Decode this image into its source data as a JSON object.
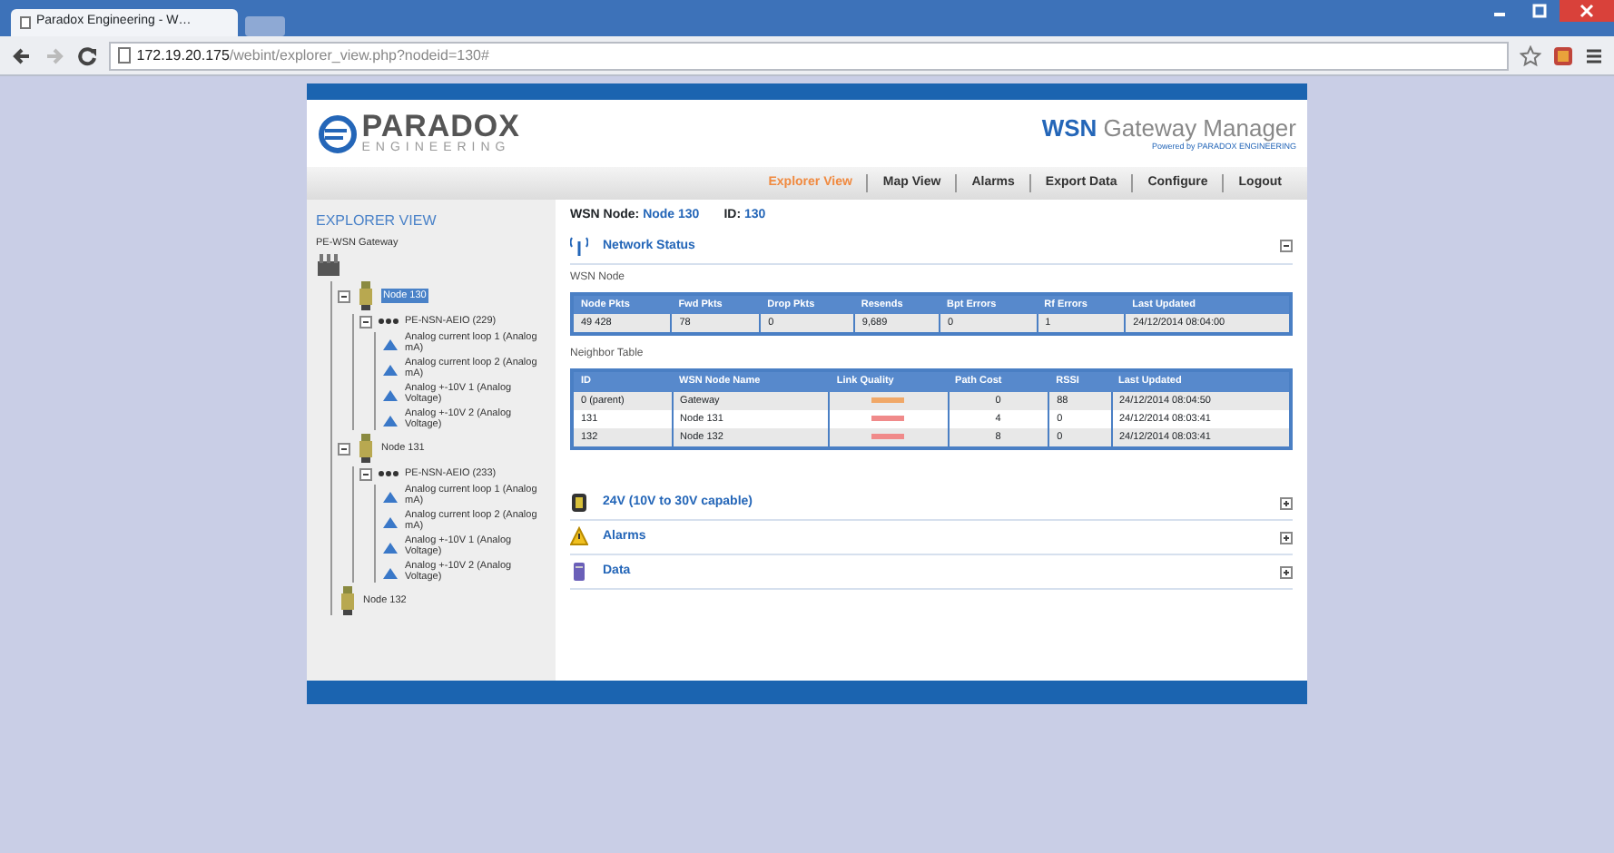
{
  "browser": {
    "tab_title": "Paradox Engineering - W…",
    "url_host": "172.19.20.175",
    "url_path": "/webint/explorer_view.php?nodeid=130#"
  },
  "header": {
    "logo_main": "PARADOX",
    "logo_sub": "ENGINEERING",
    "app_title_strong": "WSN",
    "app_title_rest": "Gateway Manager",
    "powered_by": "Powered by PARADOX ENGINEERING"
  },
  "nav": [
    {
      "label": "Explorer View",
      "selected": true
    },
    {
      "label": "Map View",
      "selected": false
    },
    {
      "label": "Alarms",
      "selected": false
    },
    {
      "label": "Export Data",
      "selected": false
    },
    {
      "label": "Configure",
      "selected": false
    },
    {
      "label": "Logout",
      "selected": false
    }
  ],
  "sidebar": {
    "title": "EXPLORER VIEW",
    "tree": [
      {
        "kind": "gateway",
        "label": "PE-WSN Gateway",
        "selected": false,
        "children": [
          {
            "kind": "node",
            "label": "Node 130",
            "selected": true,
            "expanded": true,
            "children": [
              {
                "kind": "device",
                "label": "PE-NSN-AEIO (229)",
                "selected": false,
                "expanded": true,
                "children": [
                  {
                    "kind": "sensor",
                    "label": "Analog current loop 1 (Analog mA)",
                    "selected": false
                  },
                  {
                    "kind": "sensor",
                    "label": "Analog current loop 2 (Analog mA)",
                    "selected": false
                  },
                  {
                    "kind": "sensor",
                    "label": "Analog +-10V 1 (Analog Voltage)",
                    "selected": false
                  },
                  {
                    "kind": "sensor",
                    "label": "Analog +-10V 2 (Analog Voltage)",
                    "selected": false
                  }
                ]
              }
            ]
          },
          {
            "kind": "node",
            "label": "Node 131",
            "selected": false,
            "expanded": true,
            "children": [
              {
                "kind": "device",
                "label": "PE-NSN-AEIO (233)",
                "selected": false,
                "expanded": true,
                "children": [
                  {
                    "kind": "sensor",
                    "label": "Analog current loop 1 (Analog mA)",
                    "selected": false
                  },
                  {
                    "kind": "sensor",
                    "label": "Analog current loop 2 (Analog mA)",
                    "selected": false
                  },
                  {
                    "kind": "sensor",
                    "label": "Analog +-10V 1 (Analog Voltage)",
                    "selected": false
                  },
                  {
                    "kind": "sensor",
                    "label": "Analog +-10V 2 (Analog Voltage)",
                    "selected": false
                  }
                ]
              }
            ]
          },
          {
            "kind": "node",
            "label": "Node 132",
            "selected": false
          }
        ]
      }
    ]
  },
  "main": {
    "node_label": "WSN Node:",
    "node_value": "Node 130",
    "id_label": "ID:",
    "id_value": "130",
    "sections": [
      {
        "kind": "network",
        "title": "Network Status",
        "expanded": true,
        "wsn_caption": "WSN Node",
        "wsn_table": {
          "columns": [
            "Node Pkts",
            "Fwd Pkts",
            "Drop Pkts",
            "Resends",
            "Bpt Errors",
            "Rf Errors",
            "Last Updated"
          ],
          "rows": [
            [
              "49 428",
              "78",
              "0",
              "9,689",
              "0",
              "1",
              "24/12/2014 08:04:00"
            ]
          ]
        },
        "neighbor_caption": "Neighbor Table",
        "neighbor_table": {
          "columns": [
            "ID",
            "WSN Node Name",
            "Link Quality",
            "Path Cost",
            "RSSI",
            "Last Updated"
          ],
          "rows": [
            {
              "id": "0 (parent)",
              "name": "Gateway",
              "quality": {
                "color": "#f0a868"
              },
              "cost": "0",
              "rssi": "88",
              "updated": "24/12/2014 08:04:50"
            },
            {
              "id": "131",
              "name": "Node 131",
              "quality": {
                "color": "#f08a8a"
              },
              "cost": "4",
              "rssi": "0",
              "updated": "24/12/2014 08:03:41"
            },
            {
              "id": "132",
              "name": "Node 132",
              "quality": {
                "color": "#f08a8a"
              },
              "cost": "8",
              "rssi": "0",
              "updated": "24/12/2014 08:03:41"
            }
          ]
        }
      },
      {
        "kind": "power",
        "title": "24V (10V to 30V capable)",
        "expanded": false
      },
      {
        "kind": "alarms",
        "title": "Alarms",
        "expanded": false
      },
      {
        "kind": "data",
        "title": "Data",
        "expanded": false
      }
    ]
  }
}
